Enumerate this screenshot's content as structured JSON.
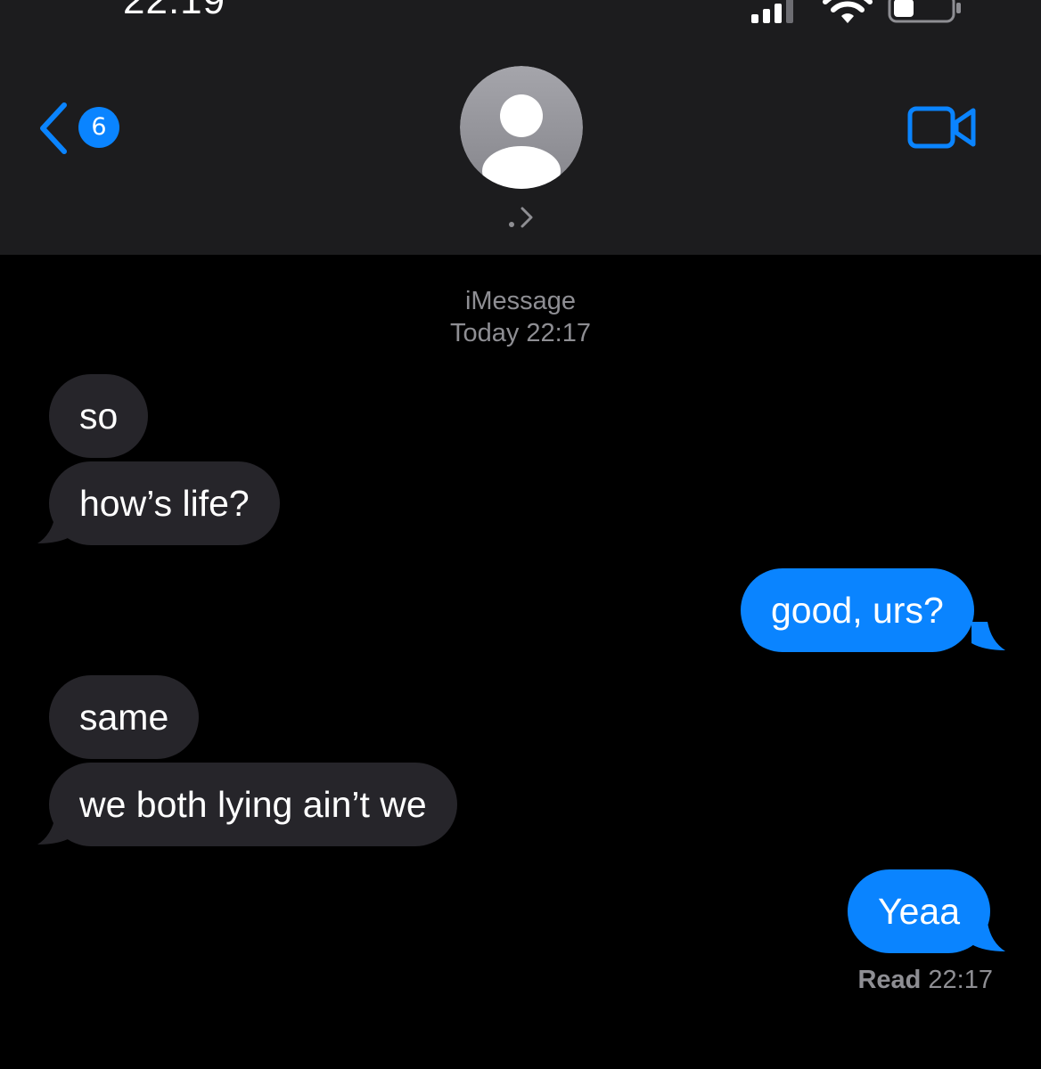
{
  "status_bar": {
    "time": "22:19",
    "icons": [
      "signal-icon",
      "wifi-icon",
      "battery-icon"
    ]
  },
  "nav": {
    "back_badge": "6",
    "contact_chevron": ".>",
    "icons": [
      "back-chevron-icon",
      "avatar-placeholder-icon",
      "video-camera-icon"
    ]
  },
  "conversation": {
    "service": "iMessage",
    "timestamp": "Today 22:17",
    "messages": [
      {
        "from": "them",
        "text": "so"
      },
      {
        "from": "them",
        "text": "how’s life?"
      },
      {
        "from": "me",
        "text": "good, urs?"
      },
      {
        "from": "them",
        "text": "same"
      },
      {
        "from": "them",
        "text": "we both lying ain’t we"
      },
      {
        "from": "me",
        "text": "Yeaa"
      }
    ],
    "read_label": "Read",
    "read_time": "22:17"
  },
  "colors": {
    "header_bg": "#1c1c1e",
    "background": "#000000",
    "incoming_bubble": "#26252a",
    "outgoing_bubble": "#0a84ff",
    "accent": "#0a84ff",
    "meta_text": "#8e8e93"
  }
}
